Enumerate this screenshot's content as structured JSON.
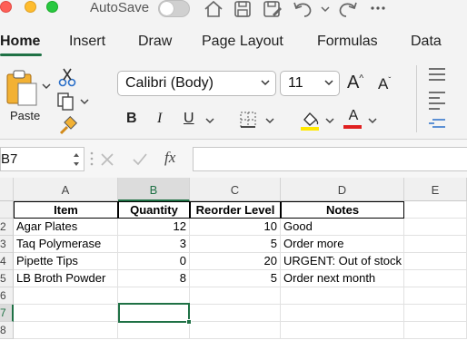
{
  "titlebar": {
    "autosave_label": "AutoSave"
  },
  "ribbon_tabs": [
    "Home",
    "Insert",
    "Draw",
    "Page Layout",
    "Formulas",
    "Data"
  ],
  "clipboard": {
    "paste_label": "Paste"
  },
  "font": {
    "family": "Calibri (Body)",
    "size": "11",
    "bold": "B",
    "italic": "I",
    "underline": "U",
    "font_color_letter": "A",
    "grow_letter": "A",
    "shrink_letter": "A"
  },
  "colors": {
    "accent_green": "#1f7145",
    "highlight_yellow": "#ffe800",
    "font_red": "#e02020"
  },
  "formula_bar": {
    "name_box": "B7",
    "fx_symbol": "fx",
    "formula": ""
  },
  "sheet": {
    "columns": [
      "A",
      "B",
      "C",
      "D",
      "E"
    ],
    "rows": [
      "2",
      "3",
      "4",
      "5",
      "6",
      "7",
      "8"
    ],
    "headers": [
      "Item",
      "Quantity",
      "Reorder Level",
      "Notes"
    ],
    "data": [
      {
        "item": "Agar Plates",
        "quantity": "12",
        "reorder": "10",
        "notes": "Good"
      },
      {
        "item": "Taq Polymerase",
        "quantity": "3",
        "reorder": "5",
        "notes": "Order more"
      },
      {
        "item": "Pipette Tips",
        "quantity": "0",
        "reorder": "20",
        "notes": "URGENT: Out of stock"
      },
      {
        "item": "LB Broth Powder",
        "quantity": "8",
        "reorder": "5",
        "notes": "Order next month"
      }
    ],
    "selected_cell": "B7"
  }
}
